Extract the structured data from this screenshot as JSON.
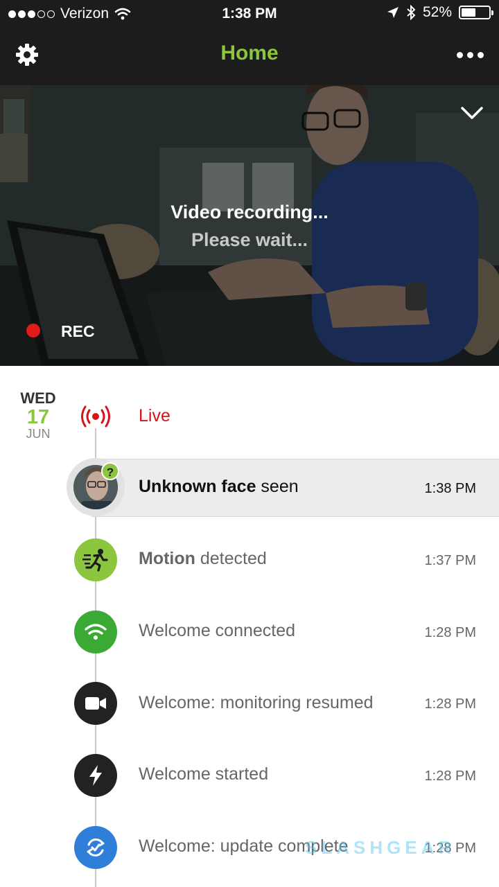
{
  "status_bar": {
    "carrier": "Verizon",
    "time": "1:38 PM",
    "battery": "52%",
    "battery_level": 0.52,
    "signal_bars_filled": 3,
    "signal_bars_total": 5
  },
  "nav": {
    "title": "Home",
    "left_icon": "gear-icon",
    "right_icon": "more-icon"
  },
  "camera": {
    "status_line1": "Video recording...",
    "status_line2": "Please wait...",
    "rec_label": "REC",
    "collapse_icon": "chevron-down-icon"
  },
  "timeline": {
    "date": {
      "dow": "WED",
      "day": "17",
      "month": "JUN"
    },
    "live_label": "Live",
    "events": [
      {
        "bold": "Unknown face",
        "rest": " seen",
        "time": "1:38 PM",
        "icon": "face-avatar",
        "color": "#e2e2e2"
      },
      {
        "bold": "Motion",
        "rest": " detected",
        "time": "1:37 PM",
        "icon": "running-person-icon",
        "color": "#8cc63f"
      },
      {
        "bold": "",
        "rest": "Welcome connected",
        "time": "1:28 PM",
        "icon": "wifi-icon",
        "color": "#3aaa35"
      },
      {
        "bold": "",
        "rest": "Welcome: monitoring resumed",
        "time": "1:28 PM",
        "icon": "video-camera-icon",
        "color": "#222222"
      },
      {
        "bold": "",
        "rest": "Welcome started",
        "time": "1:28 PM",
        "icon": "lightning-icon",
        "color": "#222222"
      },
      {
        "bold": "",
        "rest": "Welcome: update complete",
        "time": "1:28 PM",
        "icon": "update-icon",
        "color": "#2f7fd8"
      }
    ]
  },
  "watermark": "SLASHGEAR",
  "colors": {
    "accent": "#8cc63f",
    "live": "#d4141b",
    "rec": "#e11a1a"
  }
}
